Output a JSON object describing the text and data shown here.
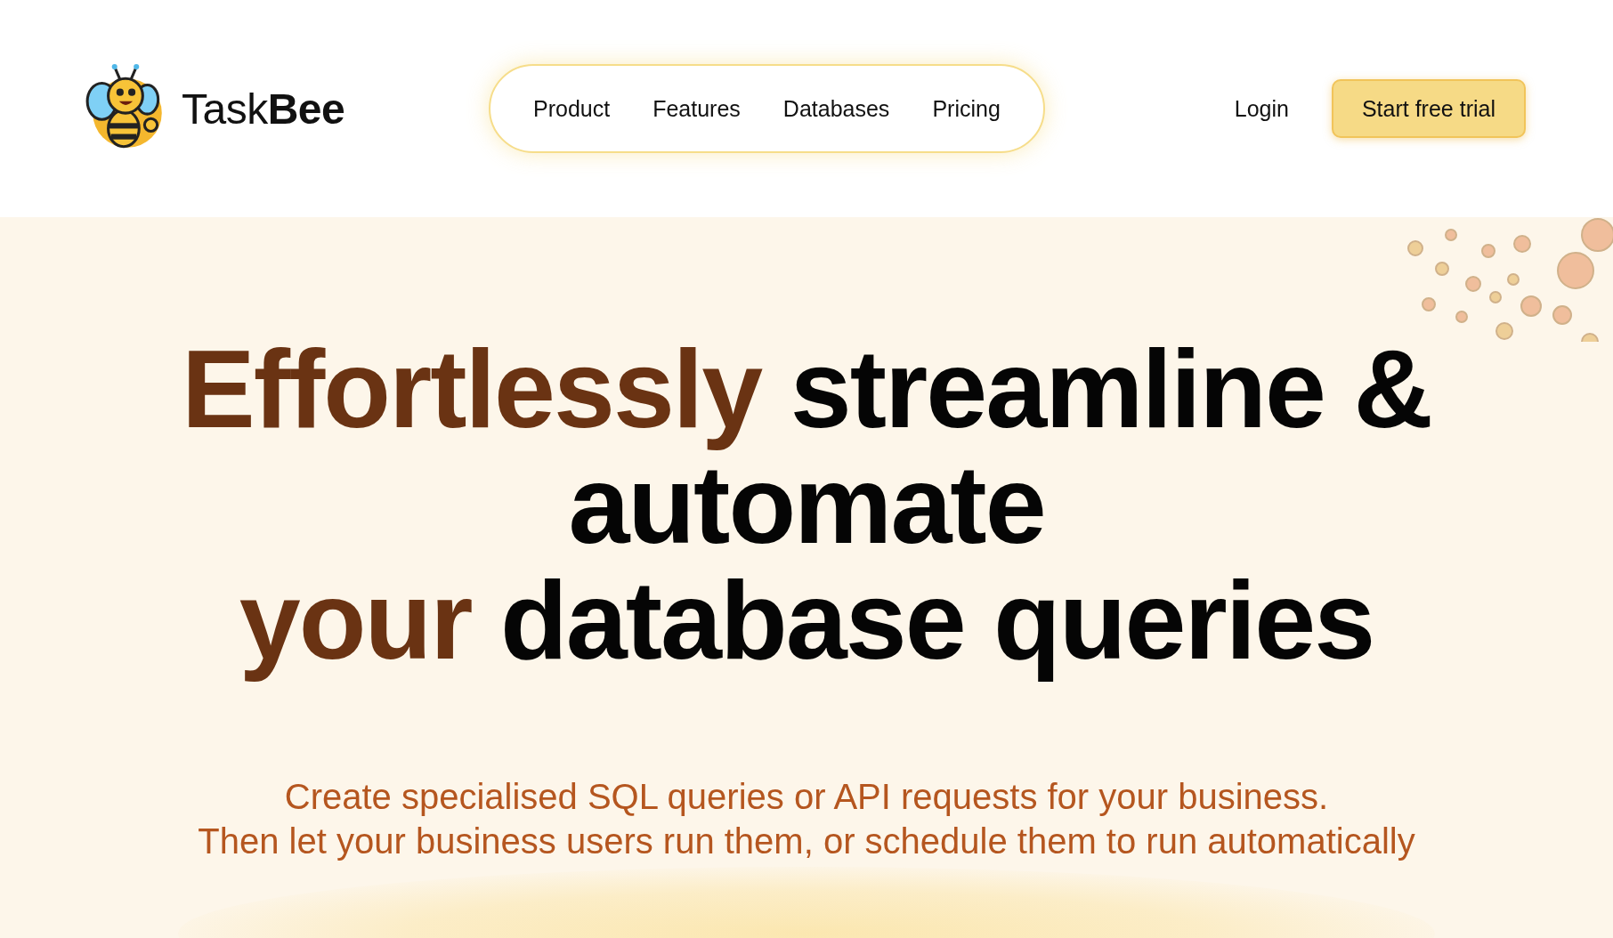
{
  "brand": {
    "name_light": "Task",
    "name_bold": "Bee"
  },
  "nav": {
    "items": [
      {
        "label": "Product"
      },
      {
        "label": "Features"
      },
      {
        "label": "Databases"
      },
      {
        "label": "Pricing"
      }
    ]
  },
  "login": "Login",
  "cta": "Start free trial",
  "headline": {
    "lines": [
      [
        {
          "text": "Effortlessly",
          "highlight": true
        },
        {
          "text": "streamline &",
          "highlight": false
        }
      ],
      [
        {
          "text": "automate",
          "highlight": false
        }
      ],
      [
        {
          "text": "your",
          "highlight": true
        },
        {
          "text": "database queries",
          "highlight": false
        }
      ]
    ]
  },
  "subtitle": [
    "Create specialised SQL queries or API requests for your business.",
    "Then let your business users run them, or schedule them to run automatically"
  ]
}
